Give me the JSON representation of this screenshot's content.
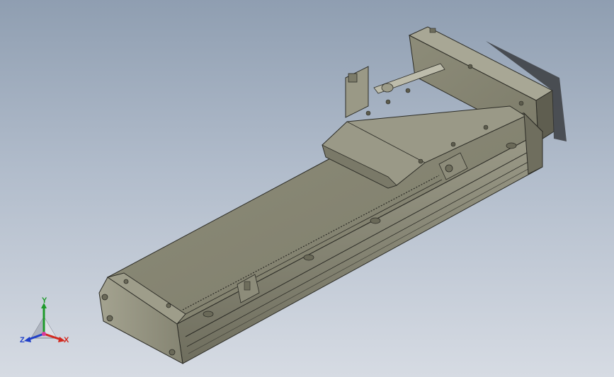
{
  "view": {
    "background_top": "#8f9eb1",
    "background_bottom": "#d6dbe3",
    "part_color": "#8b8a78",
    "edge_color": "#2c2c26"
  },
  "triad": {
    "x_label": "X",
    "y_label": "Y",
    "z_label": "Z",
    "x_color": "#d2291f",
    "y_color": "#1f9a2b",
    "z_color": "#1f3fc8"
  }
}
